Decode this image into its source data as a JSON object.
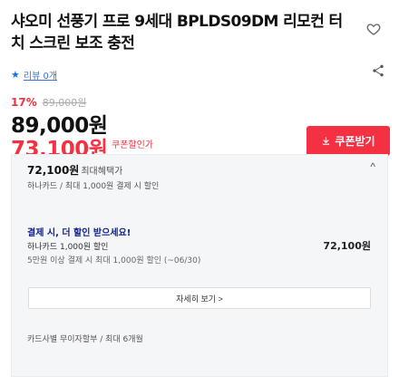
{
  "product": {
    "title": "샤오미 선풍기 프로 9세대 BPLDS09DM 리모컨 터치 스크린 보조 충전",
    "review_label": "리뷰 0개",
    "discount_rate": "17%",
    "original_price": "89,000원",
    "price": "89,000원",
    "final_price": "73,100원",
    "final_price_label": "쿠폰할인가"
  },
  "actions": {
    "coupon_label": "쿠폰받기"
  },
  "benefits": {
    "card_price": "72,100원",
    "card_price_suffix": "최대혜택가",
    "card_price_sub": "하나카드 / 최대 1,000원 결제 시 할인",
    "promo_heading": "결제 시, 더 할인 받으세요!",
    "promo_line1": "하나카드 1,000원 할인",
    "promo_line2": "5만원 이상 결제 시 최대 1,000원 할인 (~06/30)",
    "promo_price": "72,100원",
    "more_label": "자세히 보기 >",
    "card_installment": "카드사별 무이자할부 / 최대 6개월"
  },
  "colors": {
    "accent": "#f43142",
    "link": "#3b6fd1",
    "promo_heading": "#0b1f8f"
  },
  "icons": [
    "heart-icon",
    "share-icon",
    "star-icon",
    "download-icon",
    "chevron-up-icon"
  ]
}
